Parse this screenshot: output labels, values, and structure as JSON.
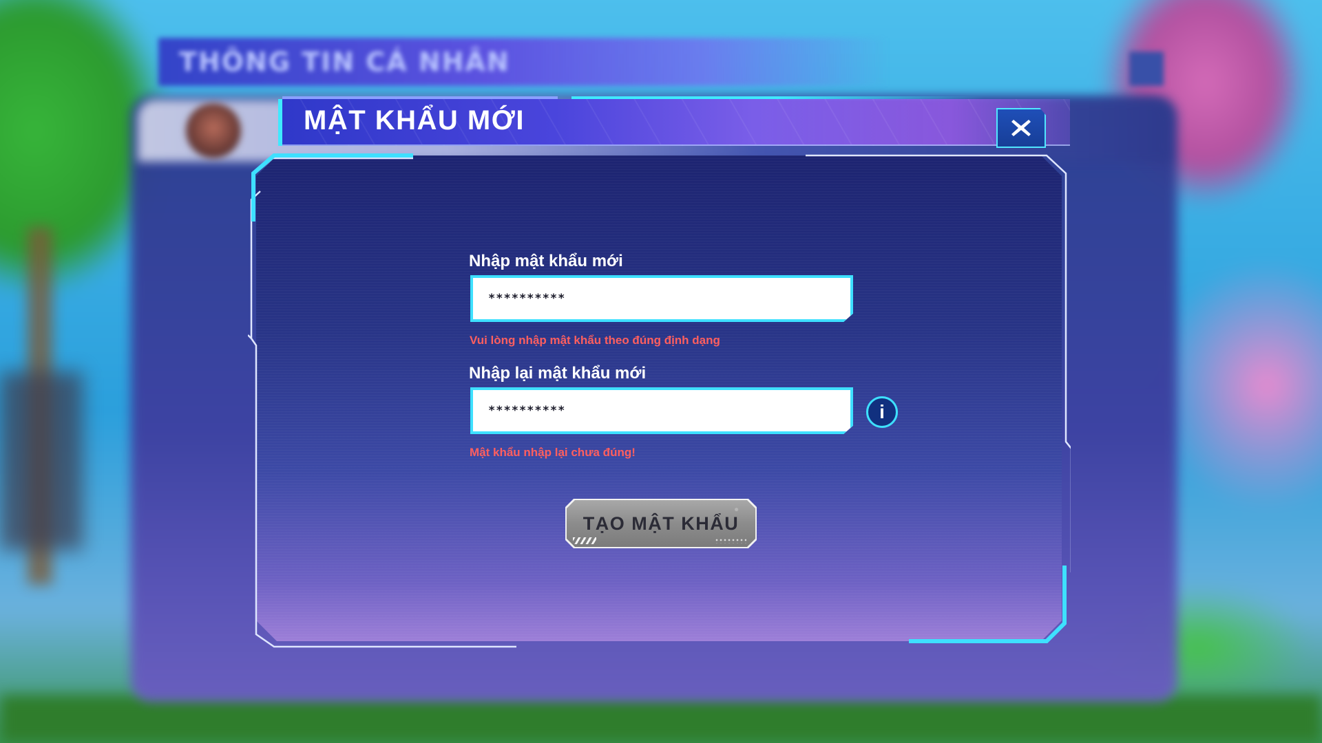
{
  "background": {
    "panel_title": "THÔNG TIN CÁ NHÂN"
  },
  "dialog": {
    "title": "MẬT KHẨU MỚI",
    "close_icon": "close-x-icon"
  },
  "form": {
    "new_password": {
      "label": "Nhập mật khẩu mới",
      "value": "**********",
      "error": "Vui lòng nhập mật khẩu theo đúng định dạng"
    },
    "confirm_password": {
      "label": "Nhập lại mật khẩu mới",
      "value": "**********",
      "error": "Mật khẩu nhập lại chưa đúng!"
    },
    "info_icon": "info-icon",
    "info_glyph": "i",
    "submit_label": "TẠO MẬT KHẨU"
  },
  "colors": {
    "accent_cyan": "#3ee0ff",
    "error_red": "#ff5f5f",
    "title_bar": "#4a45dc",
    "button_disabled": "#8c8c8c"
  }
}
